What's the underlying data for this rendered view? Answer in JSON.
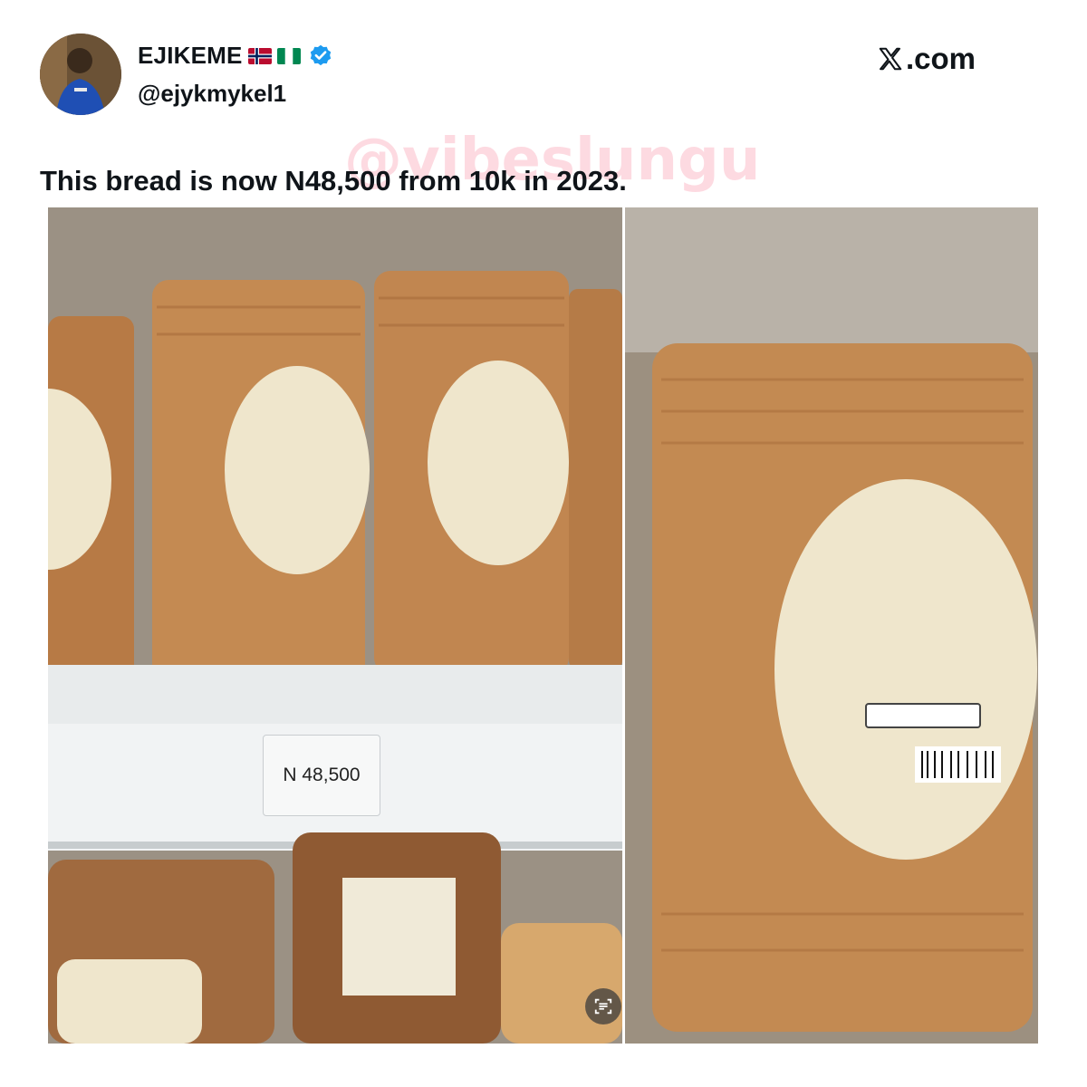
{
  "author": {
    "display_name": "EJIKEME",
    "handle": "@ejykmykel1",
    "flags": [
      "norway-flag-icon",
      "nigeria-flag-icon"
    ],
    "verified_icon": "verified-badge-icon"
  },
  "brand": {
    "site": ".com",
    "icon": "x-logo-icon"
  },
  "watermark": "@vibeslungu",
  "tweet": {
    "text": "This bread is now N48,500 from 10k in 2023."
  },
  "photo": {
    "price_tag": "N 48,500",
    "lens_icon": "text-scan-icon"
  },
  "colors": {
    "verified": "#1d9bf0",
    "text": "#0f1419",
    "watermark": "#f896aa"
  }
}
